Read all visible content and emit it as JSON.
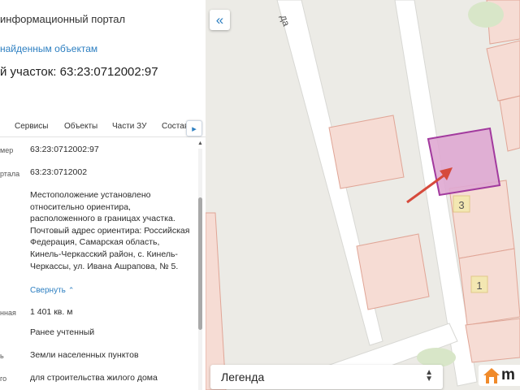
{
  "panel": {
    "portal_title": "информационный портал",
    "back_link": "найденным объектам",
    "parcel_title": "й участок: 63:23:0712002:97",
    "tabs": [
      "Сервисы",
      "Объекты",
      "Части ЗУ",
      "Состав"
    ],
    "tab_more_icon": "chevron-right-icon",
    "rows": [
      {
        "label": "мер",
        "value": "63:23:0712002:97"
      },
      {
        "label": "ртала",
        "value": "63:23:0712002"
      },
      {
        "label": "",
        "value": "Местоположение установлено относительно ориентира, расположенного в границах участка. Почтовый адрес ориентира: Российская Федерация, Самарская область, Кинель-Черкасский район, с. Кинель-Черкассы, ул. Ивана Ашрапова, № 5."
      },
      {
        "label": "нная",
        "value": "1 401 кв. м"
      },
      {
        "label": "",
        "value": "Ранее учтенный"
      },
      {
        "label": "ь",
        "value": "Земли населенных пунктов"
      },
      {
        "label": "го",
        "value": "для строительства жилого дома"
      }
    ],
    "collapse_label": "Свернуть"
  },
  "map": {
    "collapse_icon": "«",
    "street_label": "да",
    "house_numbers": [
      "3",
      "1"
    ],
    "legend_label": "Легенда",
    "logo_text": "m",
    "colors": {
      "parcel_fill": "#f6dcd4",
      "parcel_stroke": "#e0a596",
      "selected_fill": "#dfa9d2",
      "selected_stroke": "#a23a9e",
      "arrow": "#d64a3c",
      "road": "#ffffff",
      "accent": "#2d7fc1"
    }
  }
}
